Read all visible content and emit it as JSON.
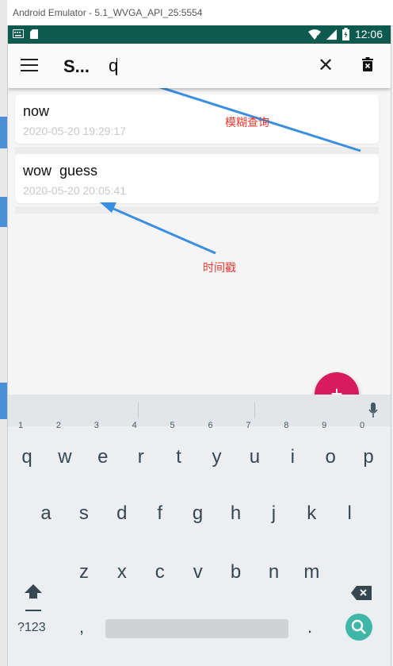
{
  "window": {
    "title": "Android Emulator - 5.1_WVGA_API_25:5554"
  },
  "status_bar": {
    "time": "12:06"
  },
  "app_bar": {
    "title": "S...",
    "search_value": "q"
  },
  "notes": [
    {
      "title": "now",
      "timestamp": "2020-05-20 19:29:17"
    },
    {
      "title": "wow  guess",
      "timestamp": "2020-05-20 20:05:41"
    }
  ],
  "annotations": {
    "fuzzy_search": "模糊查询",
    "timestamp": "时间戳"
  },
  "fab": {
    "label": "+"
  },
  "keyboard": {
    "row1_keys": [
      "q",
      "w",
      "e",
      "r",
      "t",
      "y",
      "u",
      "i",
      "o",
      "p"
    ],
    "row1_hints": [
      "",
      "1",
      "2",
      "3",
      "4",
      "5",
      "6",
      "7",
      "8",
      "9",
      "0"
    ],
    "row2_keys": [
      "a",
      "s",
      "d",
      "f",
      "g",
      "h",
      "j",
      "k",
      "l"
    ],
    "row3_keys": [
      "z",
      "x",
      "c",
      "v",
      "b",
      "n",
      "m"
    ],
    "symbols_key": "?123",
    "comma_key": ",",
    "period_key": "."
  },
  "colors": {
    "status_bar": "#0f5a4f",
    "fab": "#d81b5f",
    "annotation": "#e8392f",
    "arrow": "#3a8fe0",
    "search_key": "#40b6a8"
  }
}
